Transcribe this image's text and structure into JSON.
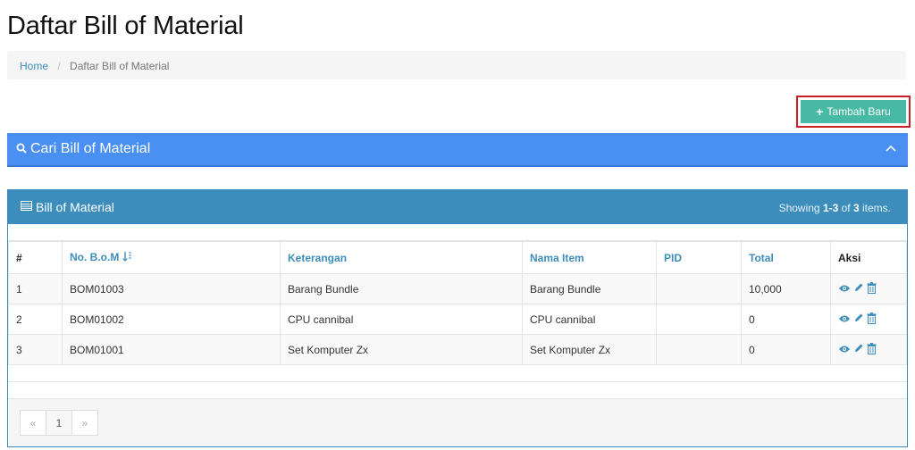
{
  "page": {
    "title": "Daftar Bill of Material"
  },
  "breadcrumb": {
    "home": "Home",
    "separator": "/",
    "current": "Daftar Bill of Material"
  },
  "toolbar": {
    "add_label": "Tambah Baru"
  },
  "search_panel": {
    "title": "Cari Bill of Material"
  },
  "grid": {
    "title": "Bill of Material",
    "summary_prefix": "Showing ",
    "summary_range": "1-3",
    "summary_mid": " of ",
    "summary_total": "3",
    "summary_suffix": " items.",
    "columns": [
      "#",
      "No. B.o.M",
      "Keterangan",
      "Nama Item",
      "PID",
      "Total",
      "Aksi"
    ],
    "rows": [
      {
        "num": "1",
        "bom": "BOM01003",
        "keterangan": "Barang Bundle",
        "nama_item": "Barang Bundle",
        "pid": "",
        "total": "10,000"
      },
      {
        "num": "2",
        "bom": "BOM01002",
        "keterangan": "CPU cannibal",
        "nama_item": "CPU cannibal",
        "pid": "",
        "total": "0"
      },
      {
        "num": "3",
        "bom": "BOM01001",
        "keterangan": "Set Komputer Zx",
        "nama_item": "Set Komputer Zx",
        "pid": "",
        "total": "0"
      }
    ]
  },
  "pagination": {
    "prev": "«",
    "current": "1",
    "next": "»"
  },
  "colors": {
    "accent": "#3c8dbc",
    "search_panel": "#4a90f2",
    "add_button": "#48b9a5",
    "highlight_border": "#c9202b"
  },
  "icons": {
    "add": "plus-icon",
    "search": "search-icon",
    "collapse": "chevron-up-icon",
    "grid": "list-icon",
    "sort": "sort-asc-icon",
    "view": "eye-icon",
    "edit": "pencil-icon",
    "delete": "trash-icon"
  }
}
